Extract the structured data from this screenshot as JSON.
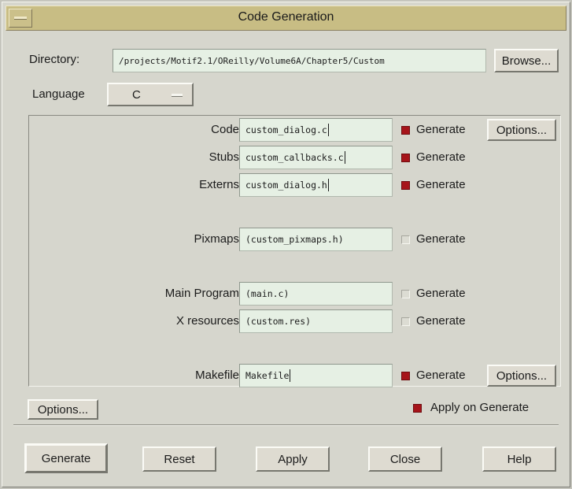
{
  "window": {
    "title": "Code Generation"
  },
  "directory": {
    "label": "Directory:",
    "value": "/projects/Motif2.1/OReilly/Volume6A/Chapter5/Custom",
    "browse_label": "Browse..."
  },
  "language": {
    "label": "Language",
    "value": "C"
  },
  "files": [
    {
      "label": "Code",
      "value": "custom_dialog.c",
      "generate_label": "Generate",
      "checked": true,
      "has_options": true,
      "options_label": "Options..."
    },
    {
      "label": "Stubs",
      "value": "custom_callbacks.c",
      "generate_label": "Generate",
      "checked": true,
      "has_options": false
    },
    {
      "label": "Externs",
      "value": "custom_dialog.h",
      "generate_label": "Generate",
      "checked": true,
      "has_options": false
    },
    {
      "label": "Pixmaps",
      "value": "(custom_pixmaps.h)",
      "generate_label": "Generate",
      "checked": false,
      "has_options": false
    },
    {
      "label": "Main Program",
      "value": "(main.c)",
      "generate_label": "Generate",
      "checked": false,
      "has_options": false
    },
    {
      "label": "X resources",
      "value": "(custom.res)",
      "generate_label": "Generate",
      "checked": false,
      "has_options": false
    },
    {
      "label": "Makefile",
      "value": "Makefile",
      "generate_label": "Generate",
      "checked": true,
      "has_options": true,
      "options_label": "Options..."
    }
  ],
  "options_button": {
    "label": "Options..."
  },
  "apply_on_generate": {
    "label": "Apply on Generate",
    "checked": true
  },
  "actions": {
    "generate": "Generate",
    "reset": "Reset",
    "apply": "Apply",
    "close": "Close",
    "help": "Help"
  },
  "colors": {
    "title_bar": "#c8bd84",
    "window_bg": "#d6d6cd",
    "field_bg": "#e6f0e4",
    "check_on": "#a6141a"
  }
}
